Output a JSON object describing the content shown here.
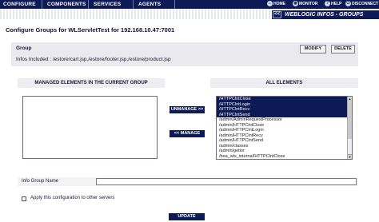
{
  "nav": {
    "tabs": [
      "CONFIGURE",
      "COMPONENTS",
      "SERVICES",
      "AGENTS"
    ],
    "tools": [
      {
        "label": "HOME",
        "icon": "home-icon",
        "glyph": "⌂"
      },
      {
        "label": "MONITOR",
        "icon": "monitor-icon",
        "glyph": "◉"
      },
      {
        "label": "HELP",
        "icon": "help-icon",
        "glyph": "?"
      },
      {
        "label": "DISCONNECT",
        "icon": "disconnect-icon",
        "glyph": "⏻"
      }
    ]
  },
  "banner": {
    "back": "<<",
    "title": "WEBLOGIC INFOS - GROUPS"
  },
  "page": {
    "title": "Configure Groups for WLServletTest for 192.168.10.47:7001"
  },
  "group": {
    "label": "Group",
    "modify": "MODIFY",
    "delete": "DELETE",
    "infos": "Infos Included : /estore/cart.jsp,/estore/footer.jsp,/estore/product.jsp"
  },
  "managed": {
    "header": "MANAGED ELEMENTS IN THE CURRENT GROUP",
    "items": []
  },
  "actions": {
    "unmanage": "UNMANAGE >>",
    "manage": "<< MANAGE"
  },
  "all": {
    "header": "ALL ELEMENTS",
    "items": [
      {
        "label": "/HTTPClntClose",
        "selected": true
      },
      {
        "label": "/HTTPClntLogin",
        "selected": true
      },
      {
        "label": "/HTTPClntRecv",
        "selected": true
      },
      {
        "label": "/HTTPClntSend",
        "selected": true
      },
      {
        "label": "/admin/AdminRequestProcessor",
        "selected": false
      },
      {
        "label": "/admin/HTTPClntClose",
        "selected": false
      },
      {
        "label": "/admin/HTTPClntLogin",
        "selected": false
      },
      {
        "label": "/admin/HTTPClntRecv",
        "selected": false
      },
      {
        "label": "/admin/HTTPClntSend",
        "selected": false
      },
      {
        "label": "/admin/classes",
        "selected": false
      },
      {
        "label": "/admin/getior",
        "selected": false
      },
      {
        "label": "/bea_wls_internal/HTTPClntClose",
        "selected": false
      }
    ]
  },
  "form": {
    "info_group_name_label": "Info Group Name",
    "info_group_name_value": "",
    "apply_label": "Apply this configuration to other servers",
    "apply_checked": false,
    "update": "UPDATE"
  },
  "colors": {
    "navy": "#0e1a55",
    "panel": "#e9e9ee"
  }
}
